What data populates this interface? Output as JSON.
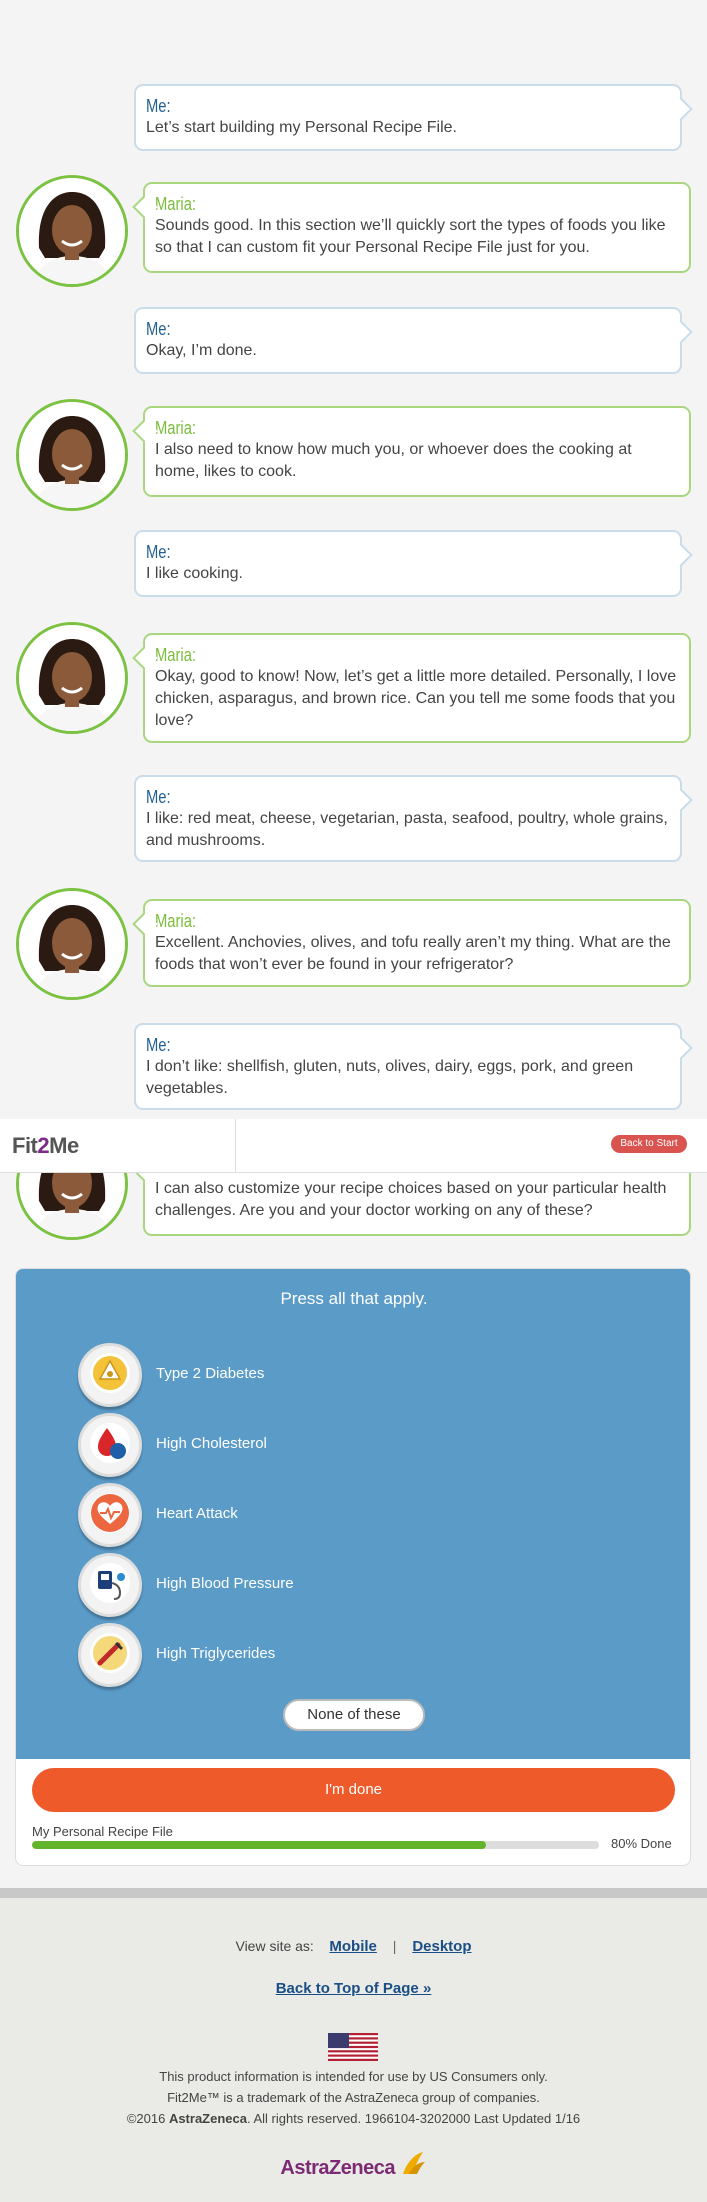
{
  "conversation": [
    {
      "speaker": "Me:",
      "text": "Let’s start building my Personal Recipe File."
    },
    {
      "speaker": "Maria:",
      "text": "Sounds good. In this section we’ll quickly sort the types of foods you like so that I can custom fit your Personal Recipe File just for you."
    },
    {
      "speaker": "Me:",
      "text": "Okay, I’m done."
    },
    {
      "speaker": "Maria:",
      "text": "I also need to know how much you, or whoever does the cooking at home, likes to cook."
    },
    {
      "speaker": "Me:",
      "text": "I like cooking."
    },
    {
      "speaker": "Maria:",
      "text": "Okay, good to know! Now, let’s get a little more detailed. Personally, I love chicken, asparagus, and brown rice. Can you tell me some foods that you love?"
    },
    {
      "speaker": "Me:",
      "text": "I like: red meat, cheese, vegetarian, pasta, seafood, poultry, whole grains, and mushrooms."
    },
    {
      "speaker": "Maria:",
      "text": "Excellent. Anchovies, olives, and tofu really aren’t my thing. What are the foods that won’t ever be found in your refrigerator?"
    },
    {
      "speaker": "Me:",
      "text": "I don’t like: shellfish, gluten, nuts, olives, dairy, eggs, pork, and green vegetables."
    },
    {
      "speaker": "Maria:",
      "text": "I can also customize your recipe choices based on your particular health challenges. Are you and your doctor working on any of these?"
    }
  ],
  "header": {
    "logo_prefix": "Fit",
    "logo_two": "2",
    "logo_suffix": "Me",
    "back_to_start": "Back to Start"
  },
  "health": {
    "prompt": "Press all that apply.",
    "options": [
      {
        "label": "Type 2 Diabetes",
        "icon": "diabetes-icon"
      },
      {
        "label": "High Cholesterol",
        "icon": "cholesterol-icon"
      },
      {
        "label": "Heart Attack",
        "icon": "heart-attack-icon"
      },
      {
        "label": "High Blood Pressure",
        "icon": "blood-pressure-icon"
      },
      {
        "label": "High Triglycerides",
        "icon": "triglycerides-icon"
      }
    ],
    "none_label": "None of these",
    "done_label": "I'm done",
    "progress_label": "My Personal Recipe File",
    "progress_value": 0.8,
    "progress_text": "80% Done"
  },
  "footer": {
    "view_site_as": "View site as:",
    "mobile": "Mobile",
    "separator": "|",
    "desktop": "Desktop",
    "back_to_top": "Back to Top of Page »",
    "line1": "This product information is intended for use by US Consumers only.",
    "line2": "Fit2Me™ is a trademark of the AstraZeneca group of companies.",
    "line3_prefix": "©2016 ",
    "line3_brand": "AstraZeneca",
    "line3_suffix": ". All rights reserved. 1966104-3202000 Last Updated 1/16",
    "brand_logo": "AstraZeneca"
  },
  "colors": {
    "me_border": "#c9dce9",
    "maria_border": "#a9d77f",
    "panel_blue": "#5a9bc8",
    "done_orange": "#ee5a2a",
    "progress_green": "#62b42b"
  }
}
